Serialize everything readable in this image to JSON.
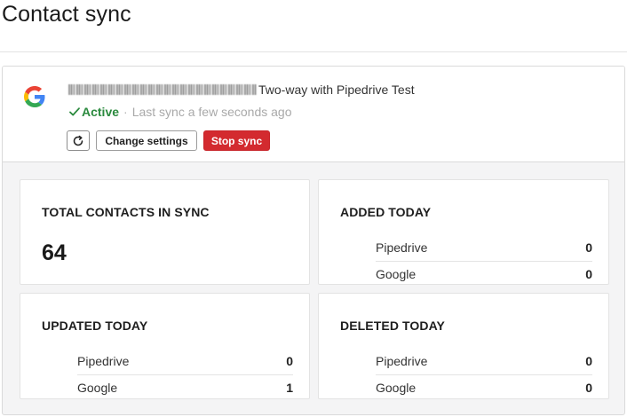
{
  "page": {
    "title": "Contact sync"
  },
  "sync": {
    "connection_name": "Two-way with Pipedrive Test",
    "status": "Active",
    "last_sync": "Last sync a few seconds ago",
    "buttons": {
      "change_settings": "Change settings",
      "stop_sync": "Stop sync"
    },
    "icons": {
      "provider": "google-logo-icon",
      "refresh": "refresh-icon",
      "status": "check-icon"
    }
  },
  "stats": {
    "total": {
      "title": "TOTAL CONTACTS IN SYNC",
      "value": "64"
    },
    "added": {
      "title": "ADDED TODAY",
      "rows": [
        {
          "label": "Pipedrive",
          "value": "0"
        },
        {
          "label": "Google",
          "value": "0"
        }
      ]
    },
    "updated": {
      "title": "UPDATED TODAY",
      "rows": [
        {
          "label": "Pipedrive",
          "value": "0"
        },
        {
          "label": "Google",
          "value": "1"
        }
      ]
    },
    "deleted": {
      "title": "DELETED TODAY",
      "rows": [
        {
          "label": "Pipedrive",
          "value": "0"
        },
        {
          "label": "Google",
          "value": "0"
        }
      ]
    }
  },
  "colors": {
    "active": "#2b8a3e",
    "danger": "#d32a2f",
    "muted": "#a9a9a9"
  }
}
